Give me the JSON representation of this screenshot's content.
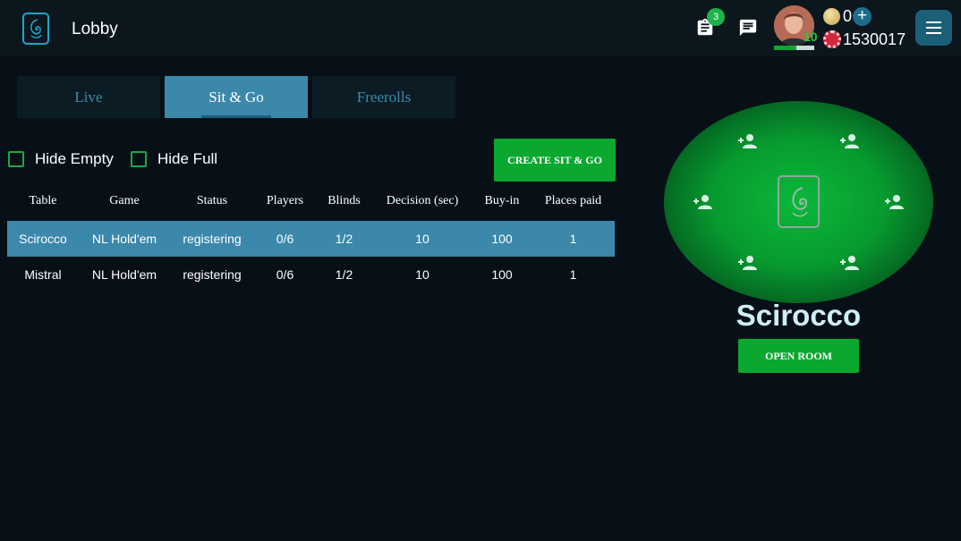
{
  "header": {
    "title": "Lobby",
    "notifications_count": "3",
    "level": "10",
    "xp_progress_percent": 55,
    "coins": "0",
    "chips": "1530017"
  },
  "tabs": [
    {
      "label": "Live",
      "active": false
    },
    {
      "label": "Sit & Go",
      "active": true
    },
    {
      "label": "Freerolls",
      "active": false
    }
  ],
  "filters": {
    "hide_empty": "Hide Empty",
    "hide_full": "Hide Full"
  },
  "create_button": "CREATE SIT & GO",
  "table": {
    "columns": [
      "Table",
      "Game",
      "Status",
      "Players",
      "Blinds",
      "Decision (sec)",
      "Buy-in",
      "Places paid"
    ],
    "rows": [
      [
        "Scirocco",
        "NL Hold'em",
        "registering",
        "0/6",
        "1/2",
        "10",
        "100",
        "1"
      ],
      [
        "Mistral",
        "NL Hold'em",
        "registering",
        "0/6",
        "1/2",
        "10",
        "100",
        "1"
      ]
    ]
  },
  "preview": {
    "table_name": "Scirocco",
    "open_button": "OPEN ROOM",
    "seats": 6
  },
  "colors": {
    "background": "#071017",
    "header": "#0b161d",
    "accent_blue": "#3b88ab",
    "accent_green": "#0aa82e",
    "felt_green": "#0bb83a"
  },
  "icons": [
    "logo-icon",
    "clipboard-icon",
    "chat-icon",
    "coin-icon",
    "plus-icon",
    "chip-icon",
    "menu-icon",
    "add-player-icon"
  ]
}
